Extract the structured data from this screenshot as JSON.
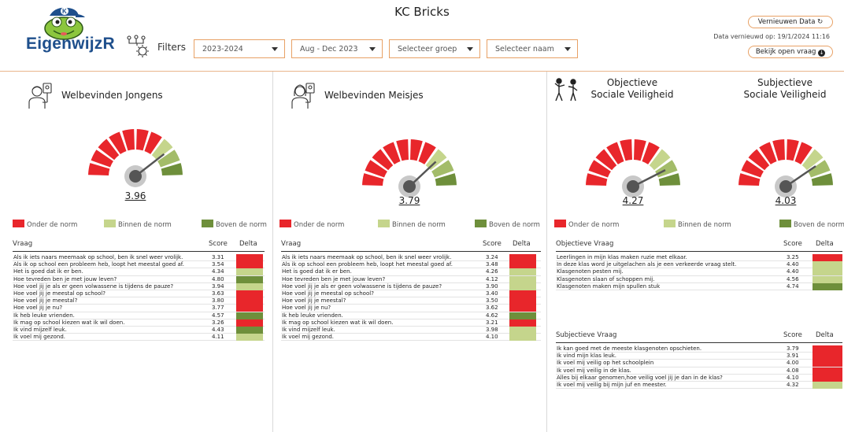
{
  "header": {
    "title": "KC Bricks",
    "logo_text": "EigenwijzR",
    "logo_cap_letter": "K",
    "filters_label": "Filters",
    "filters": [
      {
        "value": "2023-2024"
      },
      {
        "value": "Aug - Dec 2023"
      },
      {
        "placeholder": "Selecteer groep"
      },
      {
        "placeholder": "Selecteer naam"
      }
    ],
    "refresh_label": "Vernieuwen Data",
    "refresh_icon": "refresh-icon",
    "updated_label": "Data vernieuwd op:",
    "updated_date": "19/1/2024 11:16",
    "open_question_label": "Bekijk open vraag",
    "open_question_icon": "download-circle-icon"
  },
  "colors": {
    "accent": "#e8a165",
    "under": "#e8262b",
    "within": "#c5d58c",
    "above": "#6e8f3b",
    "brand": "#1e4f8c"
  },
  "legend": {
    "under": "Onder de norm",
    "within": "Binnen de norm",
    "above": "Boven de norm"
  },
  "panels": {
    "boys": {
      "title": "Welbevinden Jongens",
      "icon": "boy-person-icon",
      "gauge_value": "3.96",
      "gauge_level": 0.79,
      "cols": {
        "q": "Vraag",
        "score": "Score",
        "delta": "Delta"
      },
      "rows": [
        {
          "q": "Als ik iets naars meemaak op school, ben ik snel weer vrolijk.",
          "score": "3.31",
          "status": "under"
        },
        {
          "q": "Als ik op school een probleem heb, loopt het meestal goed af.",
          "score": "3.54",
          "status": "under"
        },
        {
          "q": "Het is goed dat ik er ben.",
          "score": "4.34",
          "status": "within"
        },
        {
          "q": "Hoe tevreden ben je met jouw leven?",
          "score": "4.80",
          "status": "above"
        },
        {
          "q": "Hoe voel jij je als er geen volwassene is tijdens de pauze?",
          "score": "3.94",
          "status": "within"
        },
        {
          "q": "Hoe voel jij je meestal op school?",
          "score": "3.63",
          "status": "under"
        },
        {
          "q": "Hoe voel jij je meestal?",
          "score": "3.80",
          "status": "under"
        },
        {
          "q": "Hoe voel jij je nu?",
          "score": "3.77",
          "status": "under"
        },
        {
          "q": "Ik heb leuke vrienden.",
          "score": "4.57",
          "status": "above"
        },
        {
          "q": "Ik mag op school kiezen wat ik wil doen.",
          "score": "3.26",
          "status": "under"
        },
        {
          "q": "Ik vind mijzelf leuk.",
          "score": "4.43",
          "status": "above"
        },
        {
          "q": "Ik voel mij gezond.",
          "score": "4.11",
          "status": "within"
        }
      ]
    },
    "girls": {
      "title": "Welbevinden Meisjes",
      "icon": "girl-person-icon",
      "gauge_value": "3.79",
      "gauge_level": 0.76,
      "cols": {
        "q": "Vraag",
        "score": "Score",
        "delta": "Delta"
      },
      "rows": [
        {
          "q": "Als ik iets naars meemaak op school, ben ik snel weer vrolijk.",
          "score": "3.24",
          "status": "under"
        },
        {
          "q": "Als ik op school een probleem heb, loopt het meestal goed af.",
          "score": "3.48",
          "status": "under"
        },
        {
          "q": "Het is goed dat ik er ben.",
          "score": "4.26",
          "status": "within"
        },
        {
          "q": "Hoe tevreden ben je met jouw leven?",
          "score": "4.12",
          "status": "within"
        },
        {
          "q": "Hoe voel jij je als er geen volwassene is tijdens de pauze?",
          "score": "3.90",
          "status": "within"
        },
        {
          "q": "Hoe voel jij je meestal op school?",
          "score": "3.40",
          "status": "under"
        },
        {
          "q": "Hoe voel jij je meestal?",
          "score": "3.50",
          "status": "under"
        },
        {
          "q": "Hoe voel jij je nu?",
          "score": "3.62",
          "status": "under"
        },
        {
          "q": "Ik heb leuke vrienden.",
          "score": "4.62",
          "status": "above"
        },
        {
          "q": "Ik mag op school kiezen wat ik wil doen.",
          "score": "3.21",
          "status": "under"
        },
        {
          "q": "Ik vind mijzelf leuk.",
          "score": "3.98",
          "status": "within"
        },
        {
          "q": "Ik voel mij gezond.",
          "score": "4.10",
          "status": "within"
        }
      ]
    },
    "objective": {
      "title_line1": "Objectieve",
      "title_line2": "Sociale Veiligheid",
      "icon": "social-safety-icon",
      "gauge_value": "4.27",
      "gauge_level": 0.85,
      "cols": {
        "q": "Objectieve Vraag",
        "score": "Score",
        "delta": "Delta"
      },
      "rows": [
        {
          "q": "Leerlingen in mijn klas maken ruzie met elkaar.",
          "score": "3.25",
          "status": "under"
        },
        {
          "q": "In deze klas word je uitgelachen als je een verkeerde vraag stelt.",
          "score": "4.40",
          "status": "within"
        },
        {
          "q": "Klasgenoten pesten mij.",
          "score": "4.40",
          "status": "within"
        },
        {
          "q": "Klasgenoten slaan of schoppen mij.",
          "score": "4.56",
          "status": "within"
        },
        {
          "q": "Klasgenoten maken mijn spullen stuk",
          "score": "4.74",
          "status": "above"
        }
      ]
    },
    "subjective": {
      "title_line1": "Subjectieve",
      "title_line2": "Sociale Veiligheid",
      "gauge_value": "4.03",
      "gauge_level": 0.81,
      "cols": {
        "q": "Subjectieve Vraag",
        "score": "Score",
        "delta": "Delta"
      },
      "rows": [
        {
          "q": "Ik kan goed met de meeste klasgenoten opschieten.",
          "score": "3.79",
          "status": "under"
        },
        {
          "q": "Ik vind mijn klas leuk.",
          "score": "3.91",
          "status": "under"
        },
        {
          "q": "Ik voel mij veilig op het schoolplein",
          "score": "4.00",
          "status": "under"
        },
        {
          "q": "Ik voel mij veilig in de klas.",
          "score": "4.08",
          "status": "under"
        },
        {
          "q": "Alles bij elkaar genomen,hoe veilig voel jij je dan in de klas?",
          "score": "4.10",
          "status": "under"
        },
        {
          "q": "Ik voel mij veilig bij mijn juf en meester.",
          "score": "4.32",
          "status": "within"
        }
      ]
    }
  }
}
